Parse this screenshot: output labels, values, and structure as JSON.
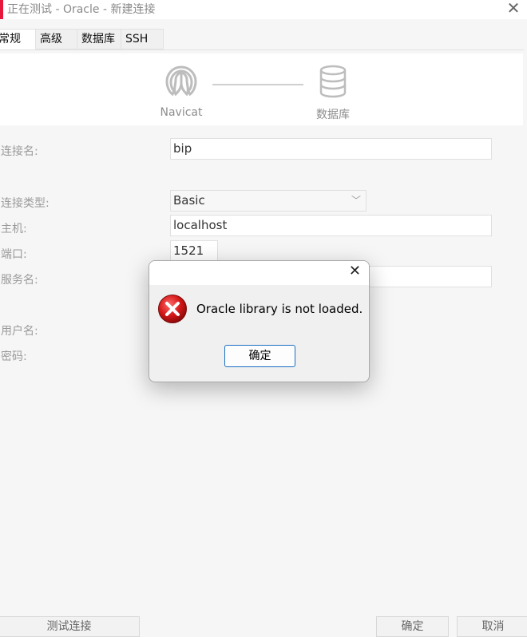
{
  "window": {
    "title": "正在测试 - Oracle - 新建连接",
    "accent_color": "#e8163d"
  },
  "tabs": [
    {
      "label": "常规",
      "active": true
    },
    {
      "label": "高级",
      "active": false
    },
    {
      "label": "数据库",
      "active": false
    },
    {
      "label": "SSH",
      "active": false
    }
  ],
  "diagram": {
    "source_label": "Navicat",
    "target_label": "数据库"
  },
  "form": {
    "connection_name_label": "连接名:",
    "connection_name_value": "bip",
    "connection_type_label": "连接类型:",
    "connection_type_value": "Basic",
    "host_label": "主机:",
    "host_value": "localhost",
    "port_label": "端口:",
    "port_value": "1521",
    "service_label": "服务名:",
    "username_label": "用户名:",
    "password_label": "密码:"
  },
  "footer": {
    "test_button": "测试连接",
    "ok_button": "确定",
    "cancel_button": "取消"
  },
  "dialog": {
    "message": "Oracle library is not loaded.",
    "ok_button": "确定",
    "icon": "error-icon",
    "button_border_color": "#1a6fc4"
  }
}
